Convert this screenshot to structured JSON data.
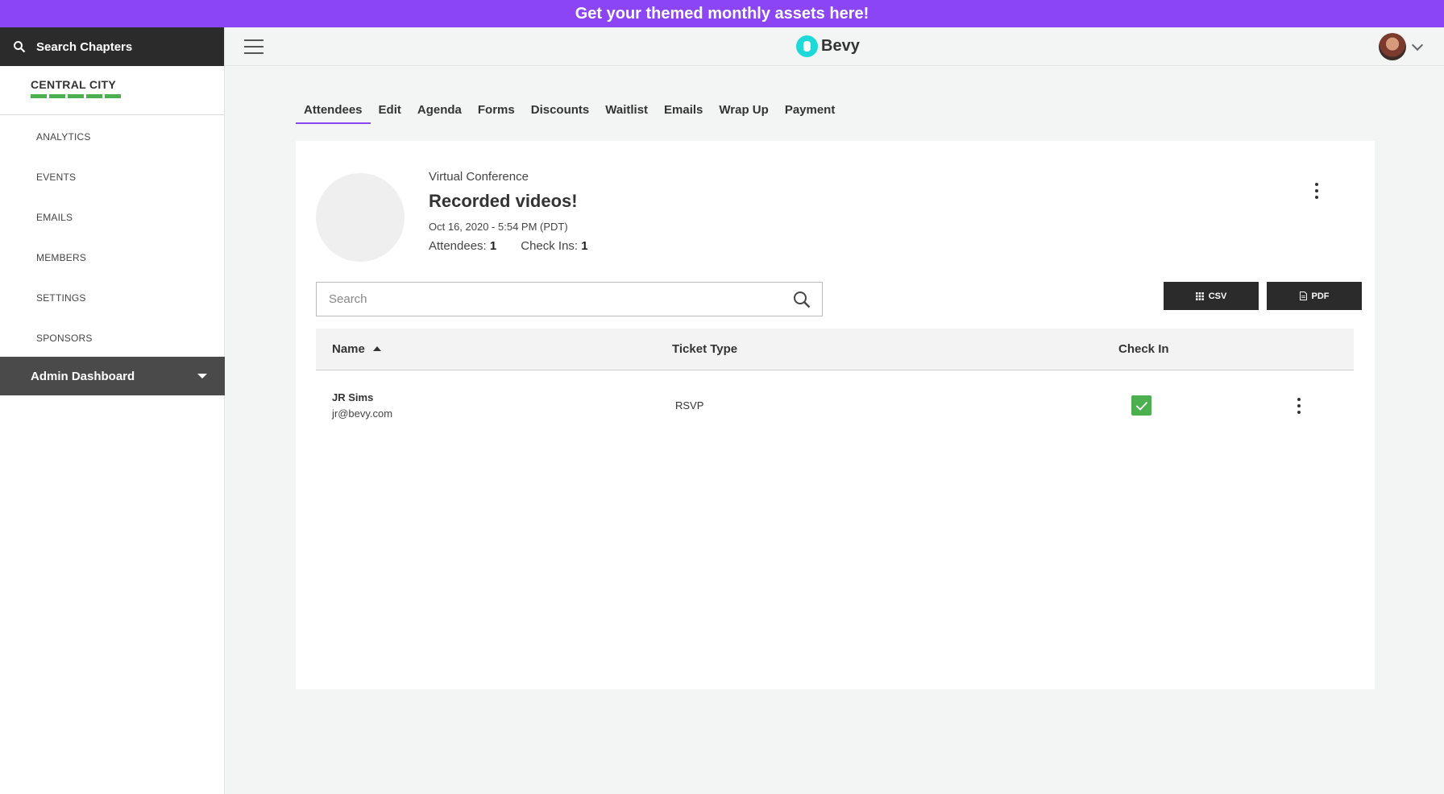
{
  "banner": {
    "text": "Get your themed monthly assets here!"
  },
  "sidebar": {
    "search_label": "Search Chapters",
    "chapter_name": "CENTRAL CITY",
    "nav": [
      "ANALYTICS",
      "EVENTS",
      "EMAILS",
      "MEMBERS",
      "SETTINGS",
      "SPONSORS"
    ],
    "admin_dashboard": "Admin Dashboard"
  },
  "header": {
    "logo_text": "Bevy"
  },
  "tabs": [
    "Attendees",
    "Edit",
    "Agenda",
    "Forms",
    "Discounts",
    "Waitlist",
    "Emails",
    "Wrap Up",
    "Payment"
  ],
  "event": {
    "type": "Virtual Conference",
    "title": "Recorded videos!",
    "date": "Oct 16, 2020 - 5:54 PM (PDT)",
    "attendees_label": "Attendees:",
    "attendees_count": "1",
    "checkins_label": "Check Ins:",
    "checkins_count": "1"
  },
  "search": {
    "placeholder": "Search"
  },
  "export": {
    "csv_label": "CSV",
    "pdf_label": "PDF"
  },
  "table": {
    "columns": {
      "name": "Name",
      "ticket_type": "Ticket Type",
      "check_in": "Check In"
    },
    "rows": [
      {
        "name": "JR Sims",
        "email": "jr@bevy.com",
        "ticket_type": "RSVP",
        "checked_in": true
      }
    ]
  },
  "colors": {
    "banner": "#8b45f5",
    "accent": "#8b45f5",
    "success": "#4caf50",
    "logo": "#1fd8d8",
    "dark": "#2b2b2b"
  },
  "icons": [
    "search-icon",
    "hamburger-icon",
    "bevy-logo-icon",
    "avatar",
    "chevron-down-icon",
    "kebab-icon",
    "grid-icon",
    "document-icon",
    "check-icon",
    "caret-down-icon",
    "sort-up-icon"
  ]
}
